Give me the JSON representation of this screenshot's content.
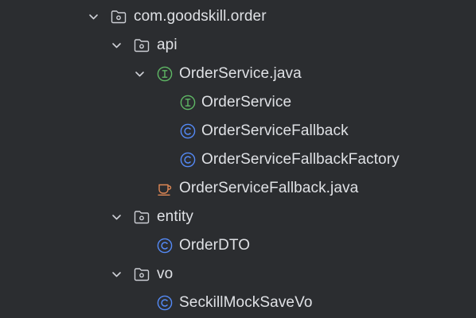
{
  "tree": [
    {
      "label": "com.goodskill.order",
      "kind": "package",
      "expanded": true,
      "depth": 0
    },
    {
      "label": "api",
      "kind": "package",
      "expanded": true,
      "depth": 1
    },
    {
      "label": "OrderService.java",
      "kind": "interface",
      "expanded": true,
      "depth": 2
    },
    {
      "label": "OrderService",
      "kind": "interface",
      "depth": 3
    },
    {
      "label": "OrderServiceFallback",
      "kind": "class",
      "depth": 3
    },
    {
      "label": "OrderServiceFallbackFactory",
      "kind": "class",
      "depth": 3
    },
    {
      "label": "OrderServiceFallback.java",
      "kind": "java-file",
      "depth": 2
    },
    {
      "label": "entity",
      "kind": "package",
      "expanded": true,
      "depth": 1
    },
    {
      "label": "OrderDTO",
      "kind": "class",
      "depth": 2
    },
    {
      "label": "vo",
      "kind": "package",
      "expanded": true,
      "depth": 1
    },
    {
      "label": "SeckillMockSaveVo",
      "kind": "class",
      "depth": 2
    }
  ],
  "colors": {
    "background": "#2b2d30",
    "text": "#dfe1e5",
    "chevron": "#ced0d6",
    "folder_icon": "#ced0d6",
    "interface_icon": "#5fb865",
    "class_icon": "#548af7",
    "java_file_icon": "#e08855"
  }
}
